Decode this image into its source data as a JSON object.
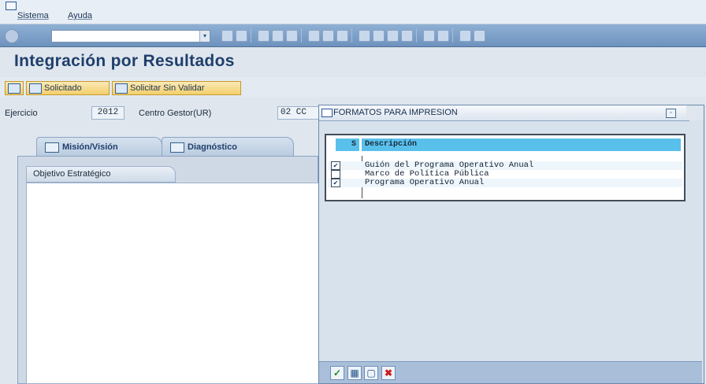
{
  "menu": {
    "items": [
      "Sistema",
      "Ayuda"
    ]
  },
  "title": "Integración por Resultados",
  "appbar": {
    "btn_solicitado": "Solicitado",
    "btn_solicitar_sin_validar": "Solicitar Sin Validar"
  },
  "header": {
    "ejercicio_label": "Ejercicio",
    "ejercicio_value": "2012",
    "centro_label": "Centro Gestor(UR)",
    "centro_value": "02 CC"
  },
  "tabs": [
    "Misión/Visión",
    "Diagnóstico"
  ],
  "panel": {
    "objective_header": "Objetivo Estratégico"
  },
  "popup": {
    "title": "FORMATOS PARA IMPRESION",
    "columns": {
      "s": "S",
      "descripcion": "Descripción"
    },
    "rows": [
      {
        "checked": true,
        "label": "Guión del Programa Operativo Anual"
      },
      {
        "checked": false,
        "label": "Marco de Política Pública"
      },
      {
        "checked": true,
        "label": "Programa Operativo Anual"
      }
    ],
    "footer_icons": [
      "check-icon",
      "select-all-icon",
      "deselect-all-icon",
      "cancel-icon"
    ]
  },
  "colors": {
    "header_blue": "#59c0eb",
    "accent_button": "#f3cf6c",
    "title_blue": "#1f3f6c"
  }
}
